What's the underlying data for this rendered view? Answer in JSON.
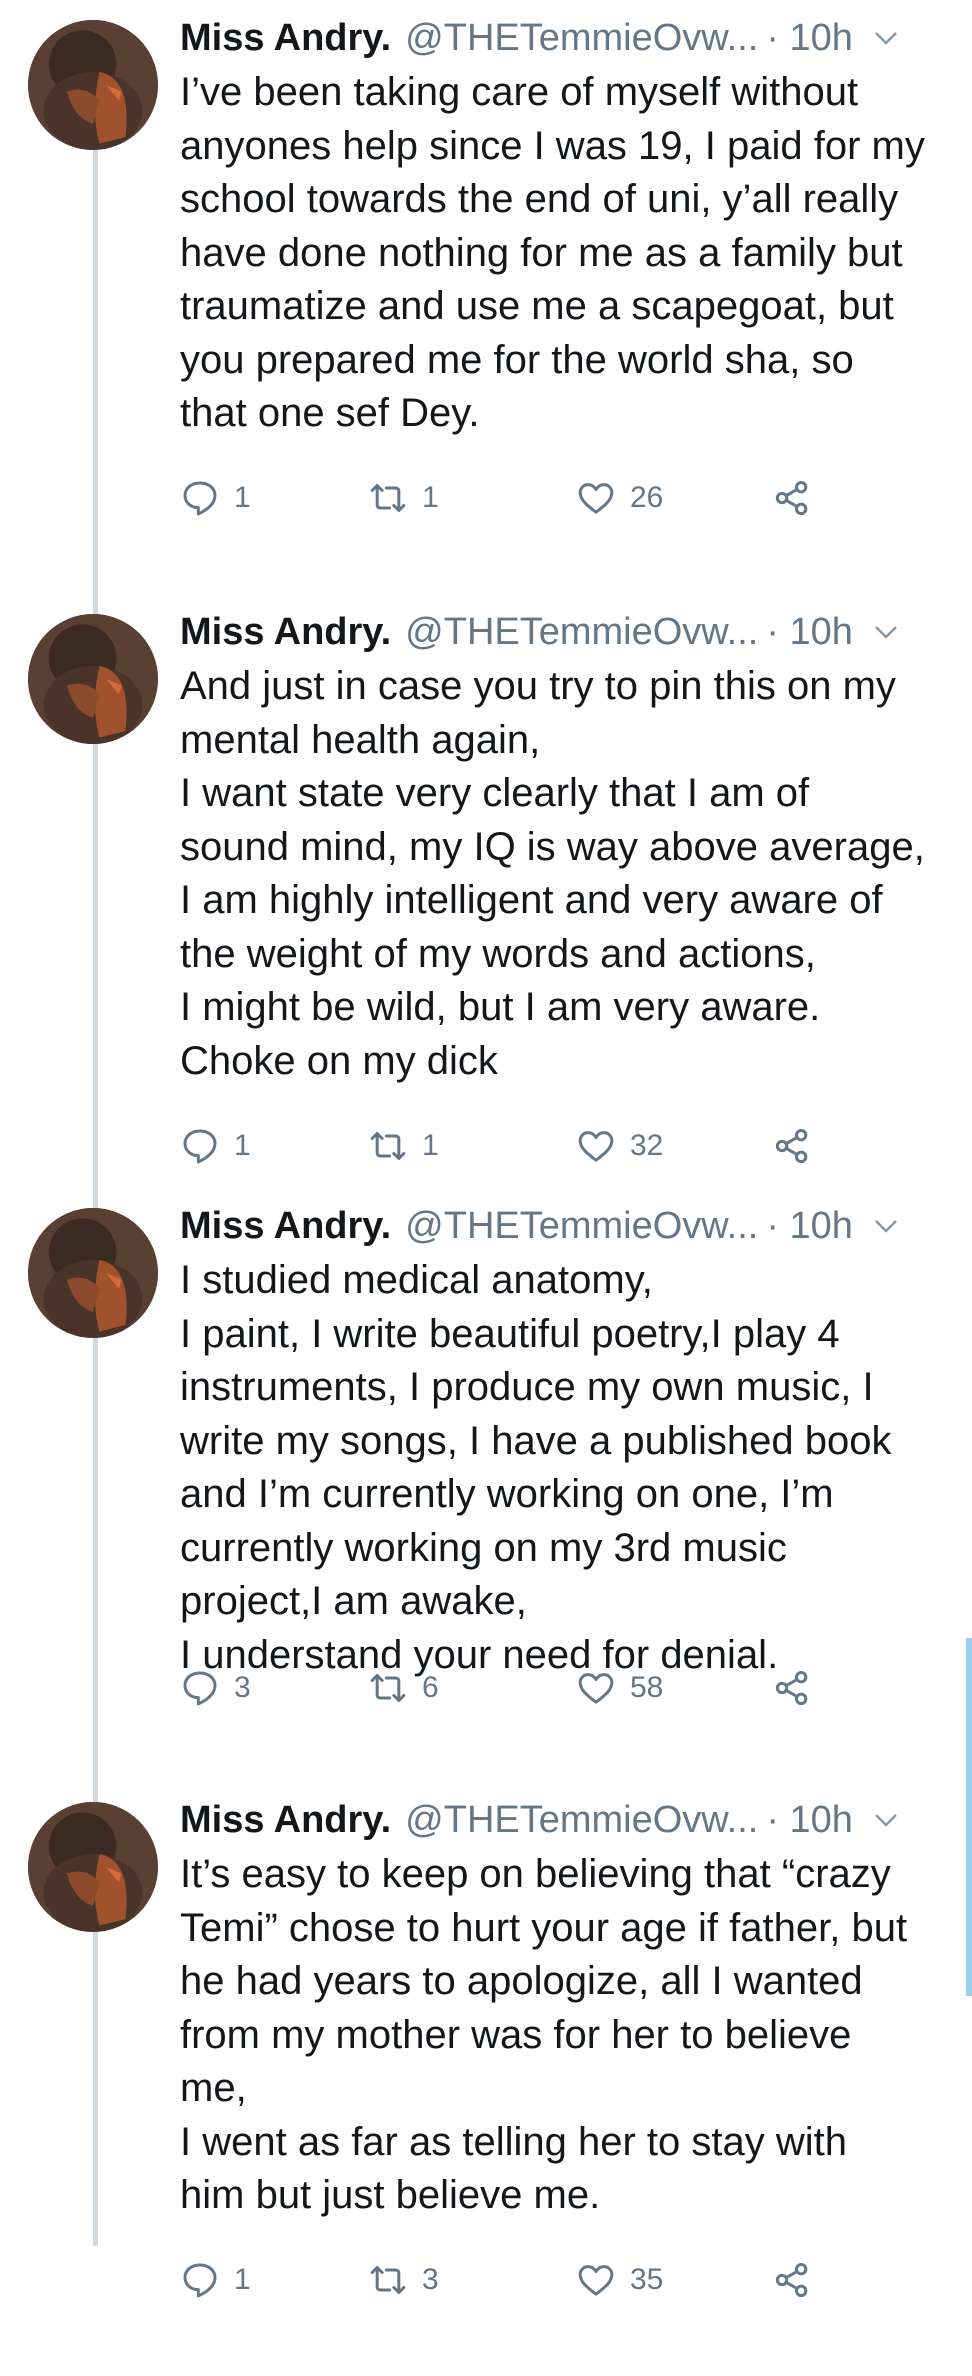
{
  "tweets": [
    {
      "author": "Miss Andry.",
      "handle": "@THETemmieOvw...",
      "time": "· 10h",
      "text": "I’ve been taking care of myself without\nanyones help since I was 19, I paid for my\nschool towards the end of uni, y’all really\nhave done nothing for me as a family but\ntraumatize and use me a scapegoat, but\nyou prepared me for the world sha, so\nthat one sef Dey.",
      "replies": "1",
      "retweets": "1",
      "likes": "26"
    },
    {
      "author": "Miss Andry.",
      "handle": "@THETemmieOvw...",
      "time": "· 10h",
      "text": "And just in case you try to pin this on my\nmental health again,\nI want state very clearly that I am of\nsound mind, my IQ is way above average,\nI am highly intelligent and very aware of\nthe weight of my words and actions,\nI might be wild, but I am very aware.\nChoke on my dick",
      "replies": "1",
      "retweets": "1",
      "likes": "32"
    },
    {
      "author": "Miss Andry.",
      "handle": "@THETemmieOvw...",
      "time": "· 10h",
      "text": "I studied medical anatomy,\nI paint, I write beautiful poetry,I play 4\ninstruments, I produce my own music, I\nwrite my songs, I have a published book\nand I’m currently working on one, I’m\ncurrently working on my 3rd music\nproject,I am awake,\nI understand your need for denial.",
      "replies": "3",
      "retweets": "6",
      "likes": "58"
    },
    {
      "author": "Miss Andry.",
      "handle": "@THETemmieOvw...",
      "time": "· 10h",
      "text": "It’s easy to keep on believing that “crazy\nTemi” chose to hurt your age if father, but\nhe had years to apologize, all I wanted\nfrom my mother was for her to believe\nme,\nI went as far as telling her to stay with\nhim but just believe me.",
      "replies": "1",
      "retweets": "3",
      "likes": "35"
    }
  ],
  "icons": {
    "reply": "reply-icon",
    "retweet": "retweet-icon",
    "like": "heart-icon",
    "share": "share-icon",
    "caret": "chevron-down-icon"
  },
  "colors": {
    "text": "#14171a",
    "muted": "#657786",
    "thread_line": "#cfd9de",
    "scrollbar": "#9ccfee"
  }
}
